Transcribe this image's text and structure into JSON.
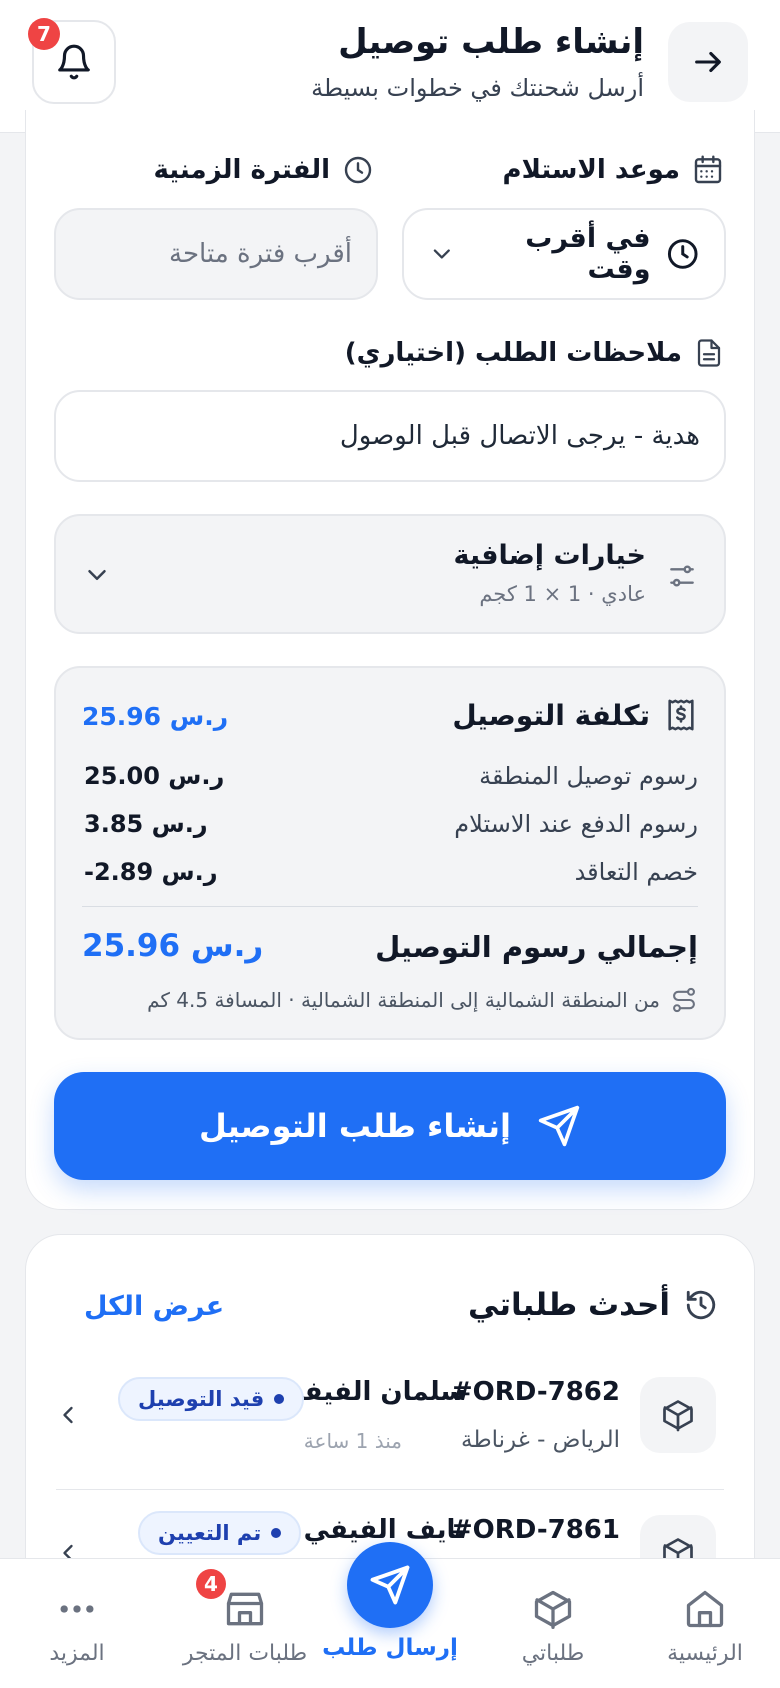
{
  "header": {
    "title": "إنشاء طلب توصيل",
    "subtitle": "أرسل شحنتك في خطوات بسيطة",
    "notification_count": "7"
  },
  "schedule": {
    "pickup_label": "موعد الاستلام",
    "pickup_value": "في أقرب وقت",
    "period_label": "الفترة الزمنية",
    "period_placeholder": "أقرب فترة متاحة"
  },
  "notes": {
    "label": "ملاحظات الطلب (اختياري)",
    "value": "هدية - يرجى الاتصال قبل الوصول"
  },
  "extras": {
    "title": "خيارات إضافية",
    "summary": "عادي · 1 × 1 كجم"
  },
  "cost": {
    "title": "تكلفة التوصيل",
    "header_value": "ر.س 25.96",
    "rows": [
      {
        "label": "رسوم توصيل المنطقة",
        "value": "ر.س 25.00"
      },
      {
        "label": "رسوم الدفع عند الاستلام",
        "value": "ر.س 3.85"
      },
      {
        "label": "خصم التعاقد",
        "value": "-2.89 ر.س"
      }
    ],
    "total_label": "إجمالي رسوم التوصيل",
    "total_value": "ر.س 25.96",
    "route_info": "من المنطقة الشمالية إلى المنطقة الشمالية · المسافة 4.5 كم"
  },
  "submit_label": "إنشاء طلب التوصيل",
  "recent": {
    "title": "أحدث طلباتي",
    "view_all": "عرض الكل",
    "orders": [
      {
        "id": "#ORD-7862",
        "name": "سلمان الفيفي",
        "route": "الرياض - غرناطة",
        "time": "منذ 1 ساعة",
        "status": "قيد التوصيل"
      },
      {
        "id": "#ORD-7861",
        "name": "نايف الفيفي",
        "route": "",
        "time": "",
        "status": "تم التعيين"
      }
    ]
  },
  "nav": {
    "home": "الرئيسية",
    "my_orders": "طلباتي",
    "send": "إرسال طلب",
    "store_orders": "طلبات المتجر",
    "store_badge": "4",
    "more": "المزيد"
  },
  "colors": {
    "accent": "#1f6ff5",
    "badge": "#ef4444"
  }
}
